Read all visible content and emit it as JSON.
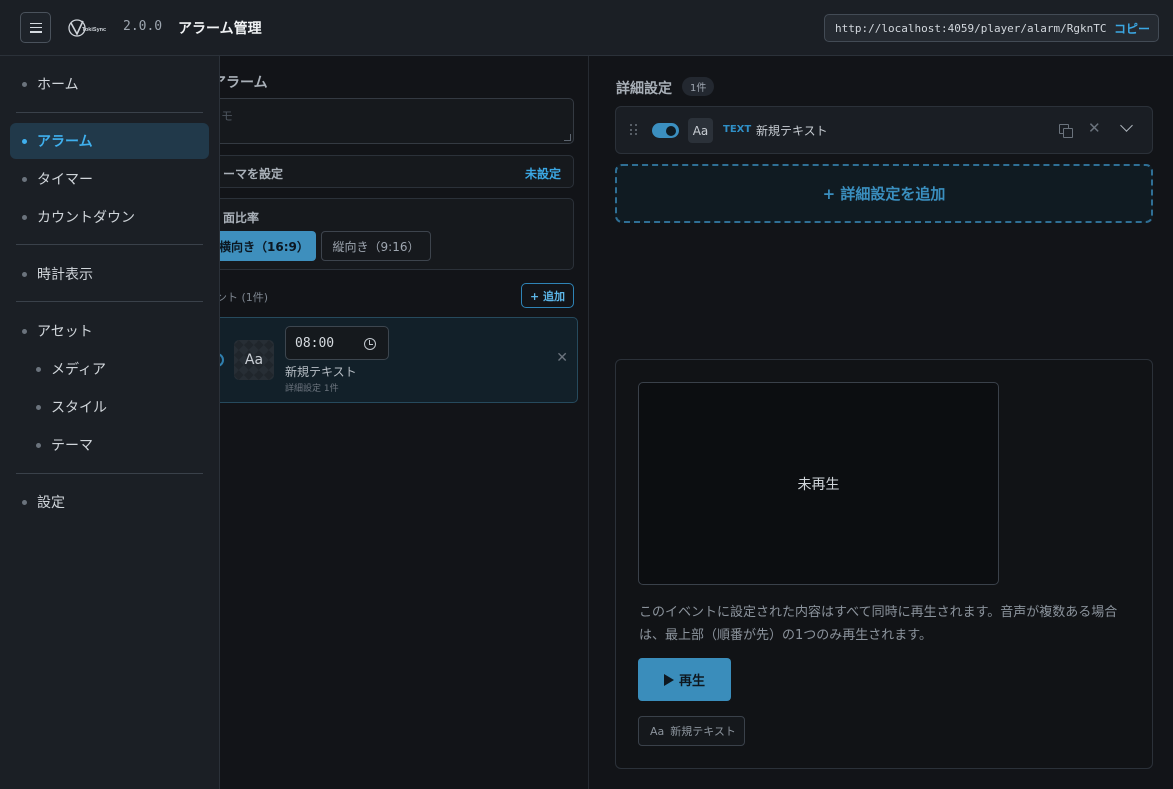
{
  "header": {
    "logo_text": "TokiSync",
    "version": "2.0.0",
    "title": "アラーム管理",
    "url": "http://localhost:4059/player/alarm/RgknTCl1sx",
    "copy_label": "コピー"
  },
  "sidebar": {
    "items": [
      {
        "label": "ホーム"
      },
      {
        "label": "アラーム",
        "active": true
      },
      {
        "label": "タイマー"
      },
      {
        "label": "カウントダウン"
      },
      {
        "label": "時計表示"
      },
      {
        "label": "アセット"
      },
      {
        "label": "メディア"
      },
      {
        "label": "スタイル"
      },
      {
        "label": "テーマ"
      },
      {
        "label": "設定"
      }
    ]
  },
  "main": {
    "heading": "アラーム",
    "textarea_placeholder": "モ",
    "theme_label": "ーマを設定",
    "theme_value": "未設定",
    "aspect_label": "面比率",
    "aspect_options": [
      "横向き（16:9）",
      "縦向き（9:16）"
    ],
    "events_label": "ント (1件)",
    "add_label": "+ 追加",
    "event": {
      "thumb": "Aa",
      "time": "08:00",
      "name": "新規テキスト",
      "sub": "詳細設定 1件",
      "close": "✕"
    }
  },
  "detail": {
    "heading": "詳細設定",
    "count": "1件",
    "item": {
      "aa": "Aa",
      "type": "TEXT",
      "name": "新規テキスト",
      "enabled": true
    },
    "add_label": "+ 詳細設定を追加"
  },
  "preview": {
    "screen_text": "未再生",
    "description": "このイベントに設定された内容はすべて同時に再生されます。音声が複数ある場合は、最上部（順番が先）の1つのみ再生されます。",
    "play_label": "再生",
    "chip_aa": "Aa",
    "chip_label": "新規テキスト"
  },
  "colors": {
    "accent": "#3ba7e3",
    "active_nav_bg": "#21394a",
    "primary_button": "#3a8dbb"
  }
}
